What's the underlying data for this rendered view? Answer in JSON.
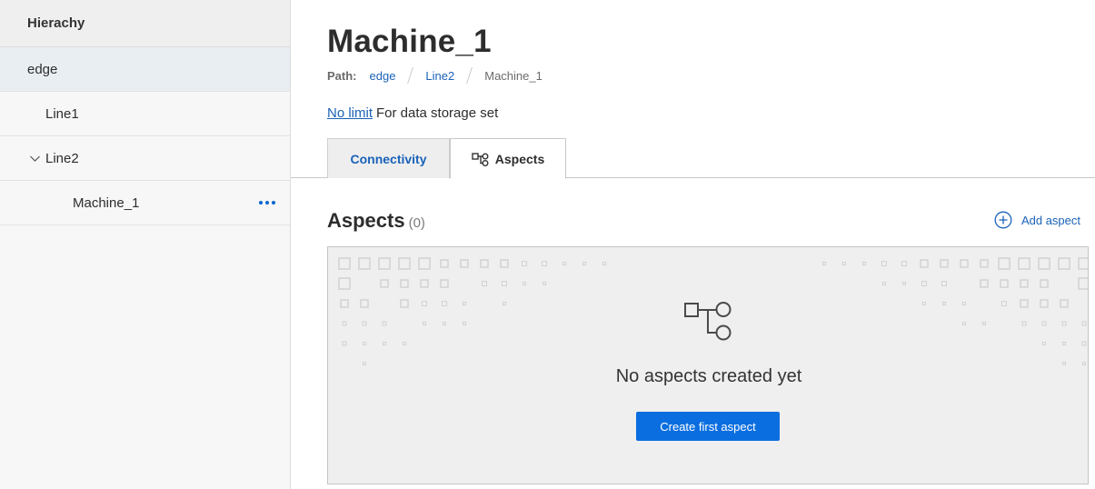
{
  "sidebar": {
    "header": "Hierachy",
    "items": [
      {
        "label": "edge"
      },
      {
        "label": "Line1"
      },
      {
        "label": "Line2"
      },
      {
        "label": "Machine_1"
      }
    ]
  },
  "main": {
    "title": "Machine_1",
    "breadcrumb": {
      "label": "Path:",
      "items": [
        "edge",
        "Line2",
        "Machine_1"
      ]
    },
    "storage": {
      "link": "No limit",
      "text": "For data storage set"
    },
    "tabs": [
      {
        "label": "Connectivity"
      },
      {
        "label": "Aspects"
      }
    ],
    "section": {
      "title": "Aspects",
      "count": "(0)",
      "add_label": "Add aspect"
    },
    "empty": {
      "message": "No aspects created yet",
      "button": "Create first aspect"
    }
  },
  "colors": {
    "accent": "#0a6ee0",
    "link": "#1a62b8",
    "selected_row": "#e9eef3"
  }
}
